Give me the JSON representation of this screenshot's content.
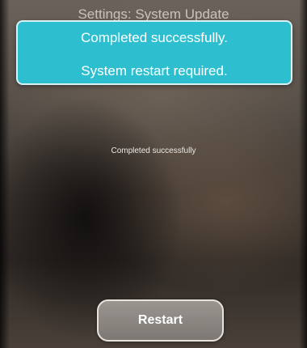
{
  "header": {
    "title": "Settings: System Update"
  },
  "notification": {
    "message": "Completed successfully.",
    "detail": "System restart required."
  },
  "main": {
    "status_text": "Completed successfully"
  },
  "actions": {
    "restart_label": "Restart"
  },
  "colors": {
    "notification_background": "#2dbfd0",
    "button_background": "#8c8782"
  }
}
